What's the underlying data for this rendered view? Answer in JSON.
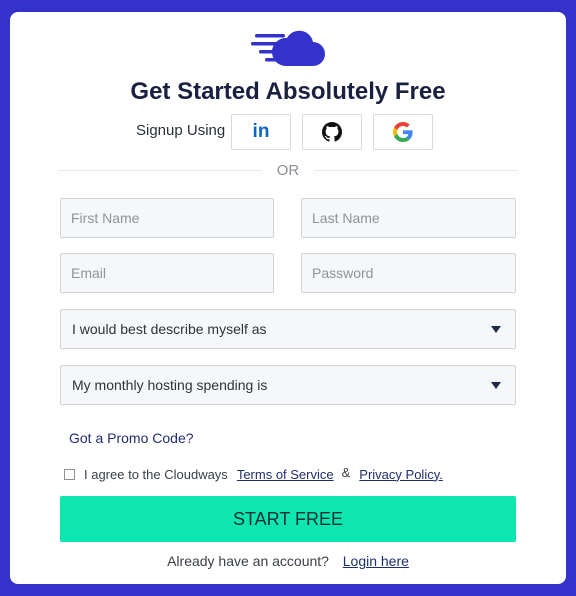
{
  "brand": {
    "logo_icon": "cloud-speed-icon",
    "color": "#3333cc"
  },
  "header": {
    "title": "Get Started Absolutely Free"
  },
  "signup": {
    "label": "Signup Using",
    "providers": [
      {
        "name": "linkedin",
        "icon": "linkedin-icon",
        "text": "in",
        "color": "#0a66c2"
      },
      {
        "name": "github",
        "icon": "github-icon"
      },
      {
        "name": "google",
        "icon": "google-icon"
      }
    ]
  },
  "divider": {
    "text": "OR"
  },
  "form": {
    "first_name_placeholder": "First Name",
    "last_name_placeholder": "Last Name",
    "email_placeholder": "Email",
    "password_placeholder": "Password",
    "describe_select": "I would best describe myself as",
    "spending_select": "My monthly hosting spending is"
  },
  "promo": {
    "label": "Got a Promo Code?"
  },
  "agreement": {
    "prefix": "I agree to the Cloudways",
    "terms_label": "Terms of Service",
    "amp": "&",
    "privacy_label": "Privacy Policy."
  },
  "submit": {
    "label": "START FREE",
    "color": "#0ee6b0"
  },
  "login": {
    "prefix": "Already have an account?",
    "link_label": "Login here"
  }
}
